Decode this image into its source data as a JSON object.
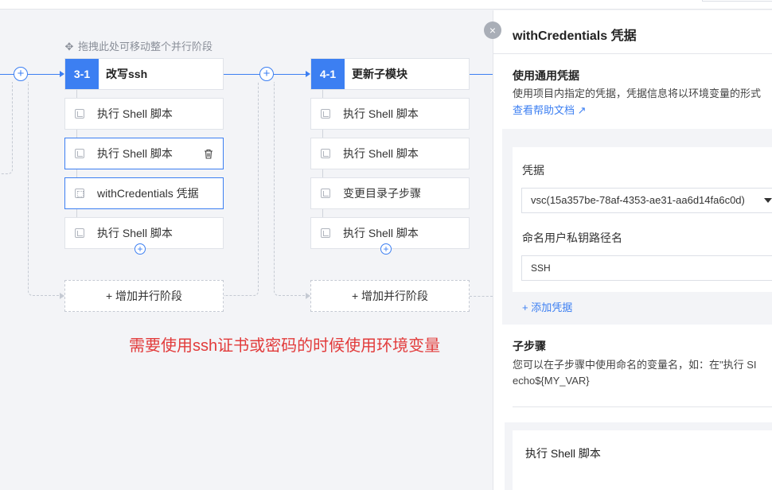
{
  "drag_hint": "拖拽此处可移动整个并行阶段",
  "stages": [
    {
      "number": "3-1",
      "name": "改写ssh",
      "steps": [
        "执行 Shell 脚本",
        "执行 Shell 脚本",
        "withCredentials 凭据",
        "执行 Shell 脚本"
      ],
      "add_parallel": "+ 增加并行阶段"
    },
    {
      "number": "4-1",
      "name": "更新子模块",
      "steps": [
        "执行 Shell 脚本",
        "执行 Shell 脚本",
        "变更目录子步骤",
        "执行 Shell 脚本"
      ],
      "add_parallel": "+ 增加并行阶段"
    }
  ],
  "annotation": "需要使用ssh证书或密码的时候使用环境变量",
  "panel": {
    "title": "withCredentials 凭据",
    "close_icon": "×",
    "section_generic": {
      "title": "使用通用凭据",
      "description": "使用项目内指定的凭据，凭据信息将以环境变量的形式",
      "help_link": "查看帮助文档 ↗"
    },
    "credential_label": "凭据",
    "credential_value": "vsc(15a357be-78af-4353-ae31-aa6d14fa6c0d)",
    "key_path_label": "命名用户私钥路径名",
    "key_path_value": "SSH",
    "add_credential": "+ 添加凭据",
    "substep_section": {
      "title": "子步骤",
      "line1": "您可以在子步骤中使用命名的变量名，如：在\"执行 SI",
      "line2": "echo${MY_VAR}"
    },
    "substep_name": "执行 Shell 脚本"
  },
  "colors": {
    "accent": "#3c7ff2",
    "annotation": "#e23b3b",
    "background": "#f3f4f7"
  }
}
